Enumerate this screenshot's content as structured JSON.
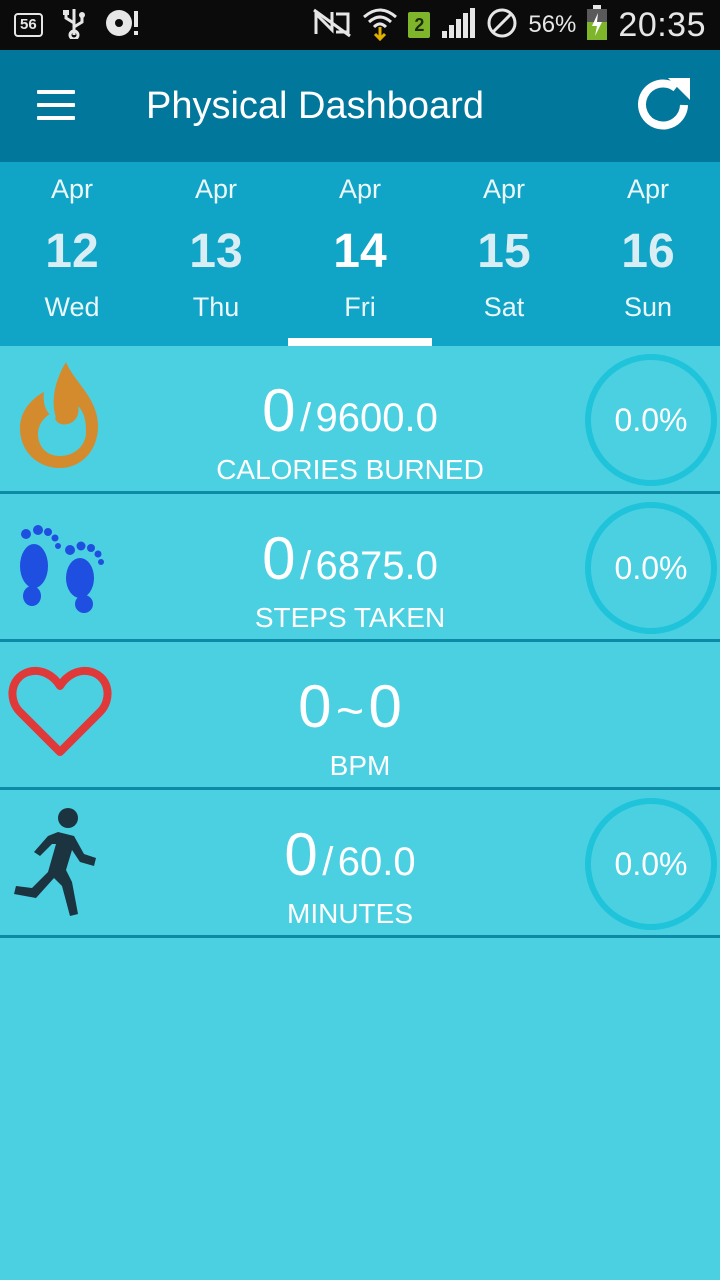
{
  "statusbar": {
    "notification_count": "56",
    "sim_slot": "2",
    "battery_percent": "56%",
    "time": "20:35"
  },
  "appbar": {
    "title": "Physical Dashboard",
    "menu_icon": "menu-icon",
    "refresh_icon": "refresh-icon"
  },
  "dates": [
    {
      "month": "Apr",
      "day": "12",
      "weekday": "Wed",
      "selected": false
    },
    {
      "month": "Apr",
      "day": "13",
      "weekday": "Thu",
      "selected": false
    },
    {
      "month": "Apr",
      "day": "14",
      "weekday": "Fri",
      "selected": true
    },
    {
      "month": "Apr",
      "day": "15",
      "weekday": "Sat",
      "selected": false
    },
    {
      "month": "Apr",
      "day": "16",
      "weekday": "Sun",
      "selected": false
    }
  ],
  "metrics": {
    "calories": {
      "value": "0",
      "separator": "/",
      "target": "9600.0",
      "label": "CALORIES BURNED",
      "percent": "0.0%",
      "icon": "flame-icon"
    },
    "steps": {
      "value": "0",
      "separator": "/",
      "target": "6875.0",
      "label": "STEPS TAKEN",
      "percent": "0.0%",
      "icon": "footprints-icon"
    },
    "heart": {
      "min": "0",
      "separator": "~",
      "max": "0",
      "label": "BPM",
      "icon": "heart-icon"
    },
    "minutes": {
      "value": "0",
      "separator": "/",
      "target": "60.0",
      "label": "MINUTES",
      "percent": "0.0%",
      "icon": "running-person-icon"
    }
  },
  "colors": {
    "background": "#4bd0e2",
    "appbar": "#02779c",
    "datestrip": "#10a4c6",
    "ring": "#1fc3da",
    "flame": "#d38b2e",
    "footprints": "#1f4fe0",
    "heart": "#e0393a",
    "runner": "#1b3440"
  }
}
